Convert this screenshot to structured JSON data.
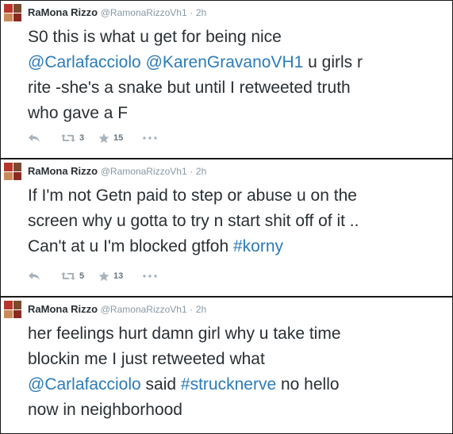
{
  "tweets": [
    {
      "author": {
        "name": "RaMona Rizzo",
        "handle": "@RamonaRizzoVh1",
        "separator": "·",
        "time": "2h"
      },
      "lines": [
        [
          {
            "text": "S0 this is what u get for being nice",
            "link": false
          }
        ],
        [
          {
            "text": "@Carlafacciolo",
            "link": true
          },
          {
            "text": " ",
            "link": false
          },
          {
            "text": "@KarenGravanoVH1",
            "link": true
          },
          {
            "text": " u girls r",
            "link": false
          }
        ],
        [
          {
            "text": "rite -she's a snake but until I retweeted truth",
            "link": false
          }
        ],
        [
          {
            "text": "who gave a F",
            "link": false
          }
        ]
      ],
      "actions": {
        "reply_icon": "reply-icon",
        "retweet_icon": "retweet-icon",
        "retweet_count": "3",
        "favorite_icon": "star-icon",
        "favorite_count": "15",
        "more_icon": "more-dots-icon"
      }
    },
    {
      "author": {
        "name": "RaMona Rizzo",
        "handle": "@RamonaRizzoVh1",
        "separator": "·",
        "time": "2h"
      },
      "lines": [
        [
          {
            "text": "If I'm not Getn paid to step or abuse u on the",
            "link": false
          }
        ],
        [
          {
            "text": "screen why u gotta to try n start shit off of it ..",
            "link": false
          }
        ],
        [
          {
            "text": "Can't at u I'm blocked gtfoh ",
            "link": false
          },
          {
            "text": "#korny",
            "link": true
          }
        ]
      ],
      "actions": {
        "reply_icon": "reply-icon",
        "retweet_icon": "retweet-icon",
        "retweet_count": "5",
        "favorite_icon": "star-icon",
        "favorite_count": "13",
        "more_icon": "more-dots-icon"
      }
    },
    {
      "author": {
        "name": "RaMona Rizzo",
        "handle": "@RamonaRizzoVh1",
        "separator": "·",
        "time": "2h"
      },
      "lines": [
        [
          {
            "text": "her feelings hurt damn girl why u take time",
            "link": false
          }
        ],
        [
          {
            "text": "blockin me I just retweeted what",
            "link": false
          }
        ],
        [
          {
            "text": "@Carlafacciolo",
            "link": true
          },
          {
            "text": " said ",
            "link": false
          },
          {
            "text": "#strucknerve",
            "link": true
          },
          {
            "text": " no hello",
            "link": false
          }
        ],
        [
          {
            "text": "now in neighborhood",
            "link": false
          }
        ]
      ]
    }
  ],
  "colors": {
    "text": "#292f33",
    "muted": "#8899a6",
    "link": "#2b7bb9",
    "border": "#1a1a1a"
  }
}
